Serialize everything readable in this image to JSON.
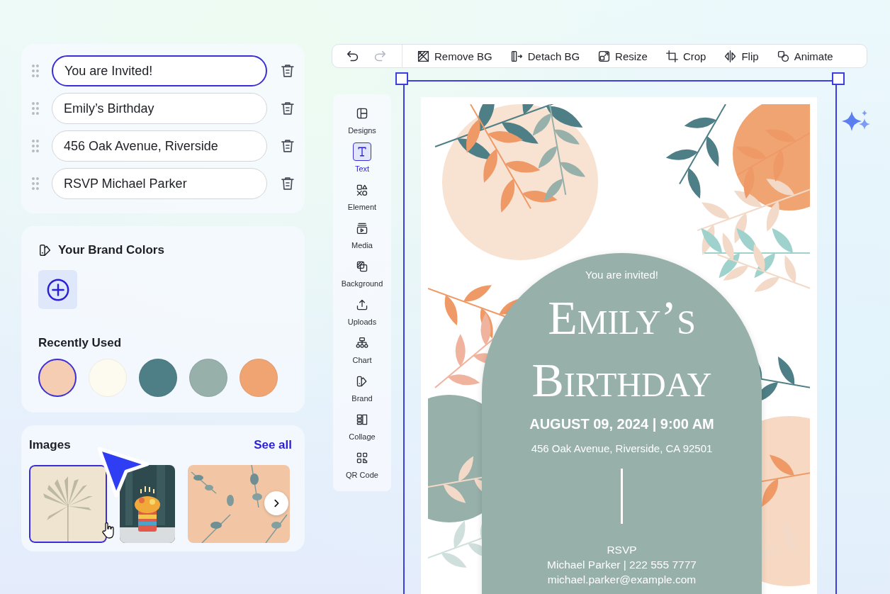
{
  "text_fields": [
    {
      "value": "You are Invited!",
      "selected": true
    },
    {
      "value": "Emily’s Birthday",
      "selected": false
    },
    {
      "value": "456 Oak Avenue, Riverside",
      "selected": false
    },
    {
      "value": "RSVP Michael Parker",
      "selected": false
    }
  ],
  "brand_colors": {
    "title": "Your Brand Colors"
  },
  "recently_used": {
    "title": "Recently Used",
    "colors": [
      {
        "color": "#f5cdb3",
        "selected": true
      },
      {
        "color": "#fdfbf0",
        "selected": false
      },
      {
        "color": "#4e7f86",
        "selected": false
      },
      {
        "color": "#97b0aa",
        "selected": false
      },
      {
        "color": "#f0a472",
        "selected": false
      }
    ]
  },
  "images": {
    "title": "Images",
    "link": "See all",
    "items": [
      {
        "kind": "picture",
        "selected": true
      },
      {
        "kind": "picture",
        "selected": false
      },
      {
        "kind": "picture",
        "selected": false
      }
    ]
  },
  "toolbar": {
    "history": [
      {
        "kind": "undo",
        "disabled": false
      },
      {
        "kind": "redo",
        "disabled": true
      }
    ],
    "buttons": [
      {
        "label": "Remove BG"
      },
      {
        "label": "Detach BG"
      },
      {
        "label": "Resize"
      },
      {
        "label": "Crop"
      },
      {
        "label": "Flip"
      },
      {
        "label": "Animate"
      }
    ]
  },
  "side_nav": [
    {
      "label": "Designs",
      "selected": false
    },
    {
      "label": "Text",
      "selected": true
    },
    {
      "label": "Element",
      "selected": false
    },
    {
      "label": "Media",
      "selected": false
    },
    {
      "label": "Background",
      "selected": false
    },
    {
      "label": "Uploads",
      "selected": false
    },
    {
      "label": "Chart",
      "selected": false
    },
    {
      "label": "Brand",
      "selected": false
    },
    {
      "label": "Collage",
      "selected": false
    },
    {
      "label": "QR Code",
      "selected": false
    }
  ],
  "invitation": {
    "intro": "You are invited!",
    "title": "Emily’s Birthday",
    "date": "AUGUST 09, 2024 | 9:00 AM",
    "address": "456 Oak Avenue, Riverside, CA 92501",
    "rsvp": "RSVP",
    "contact": "Michael Parker | 222 555 7777",
    "email": "michael.parker@example.com"
  }
}
